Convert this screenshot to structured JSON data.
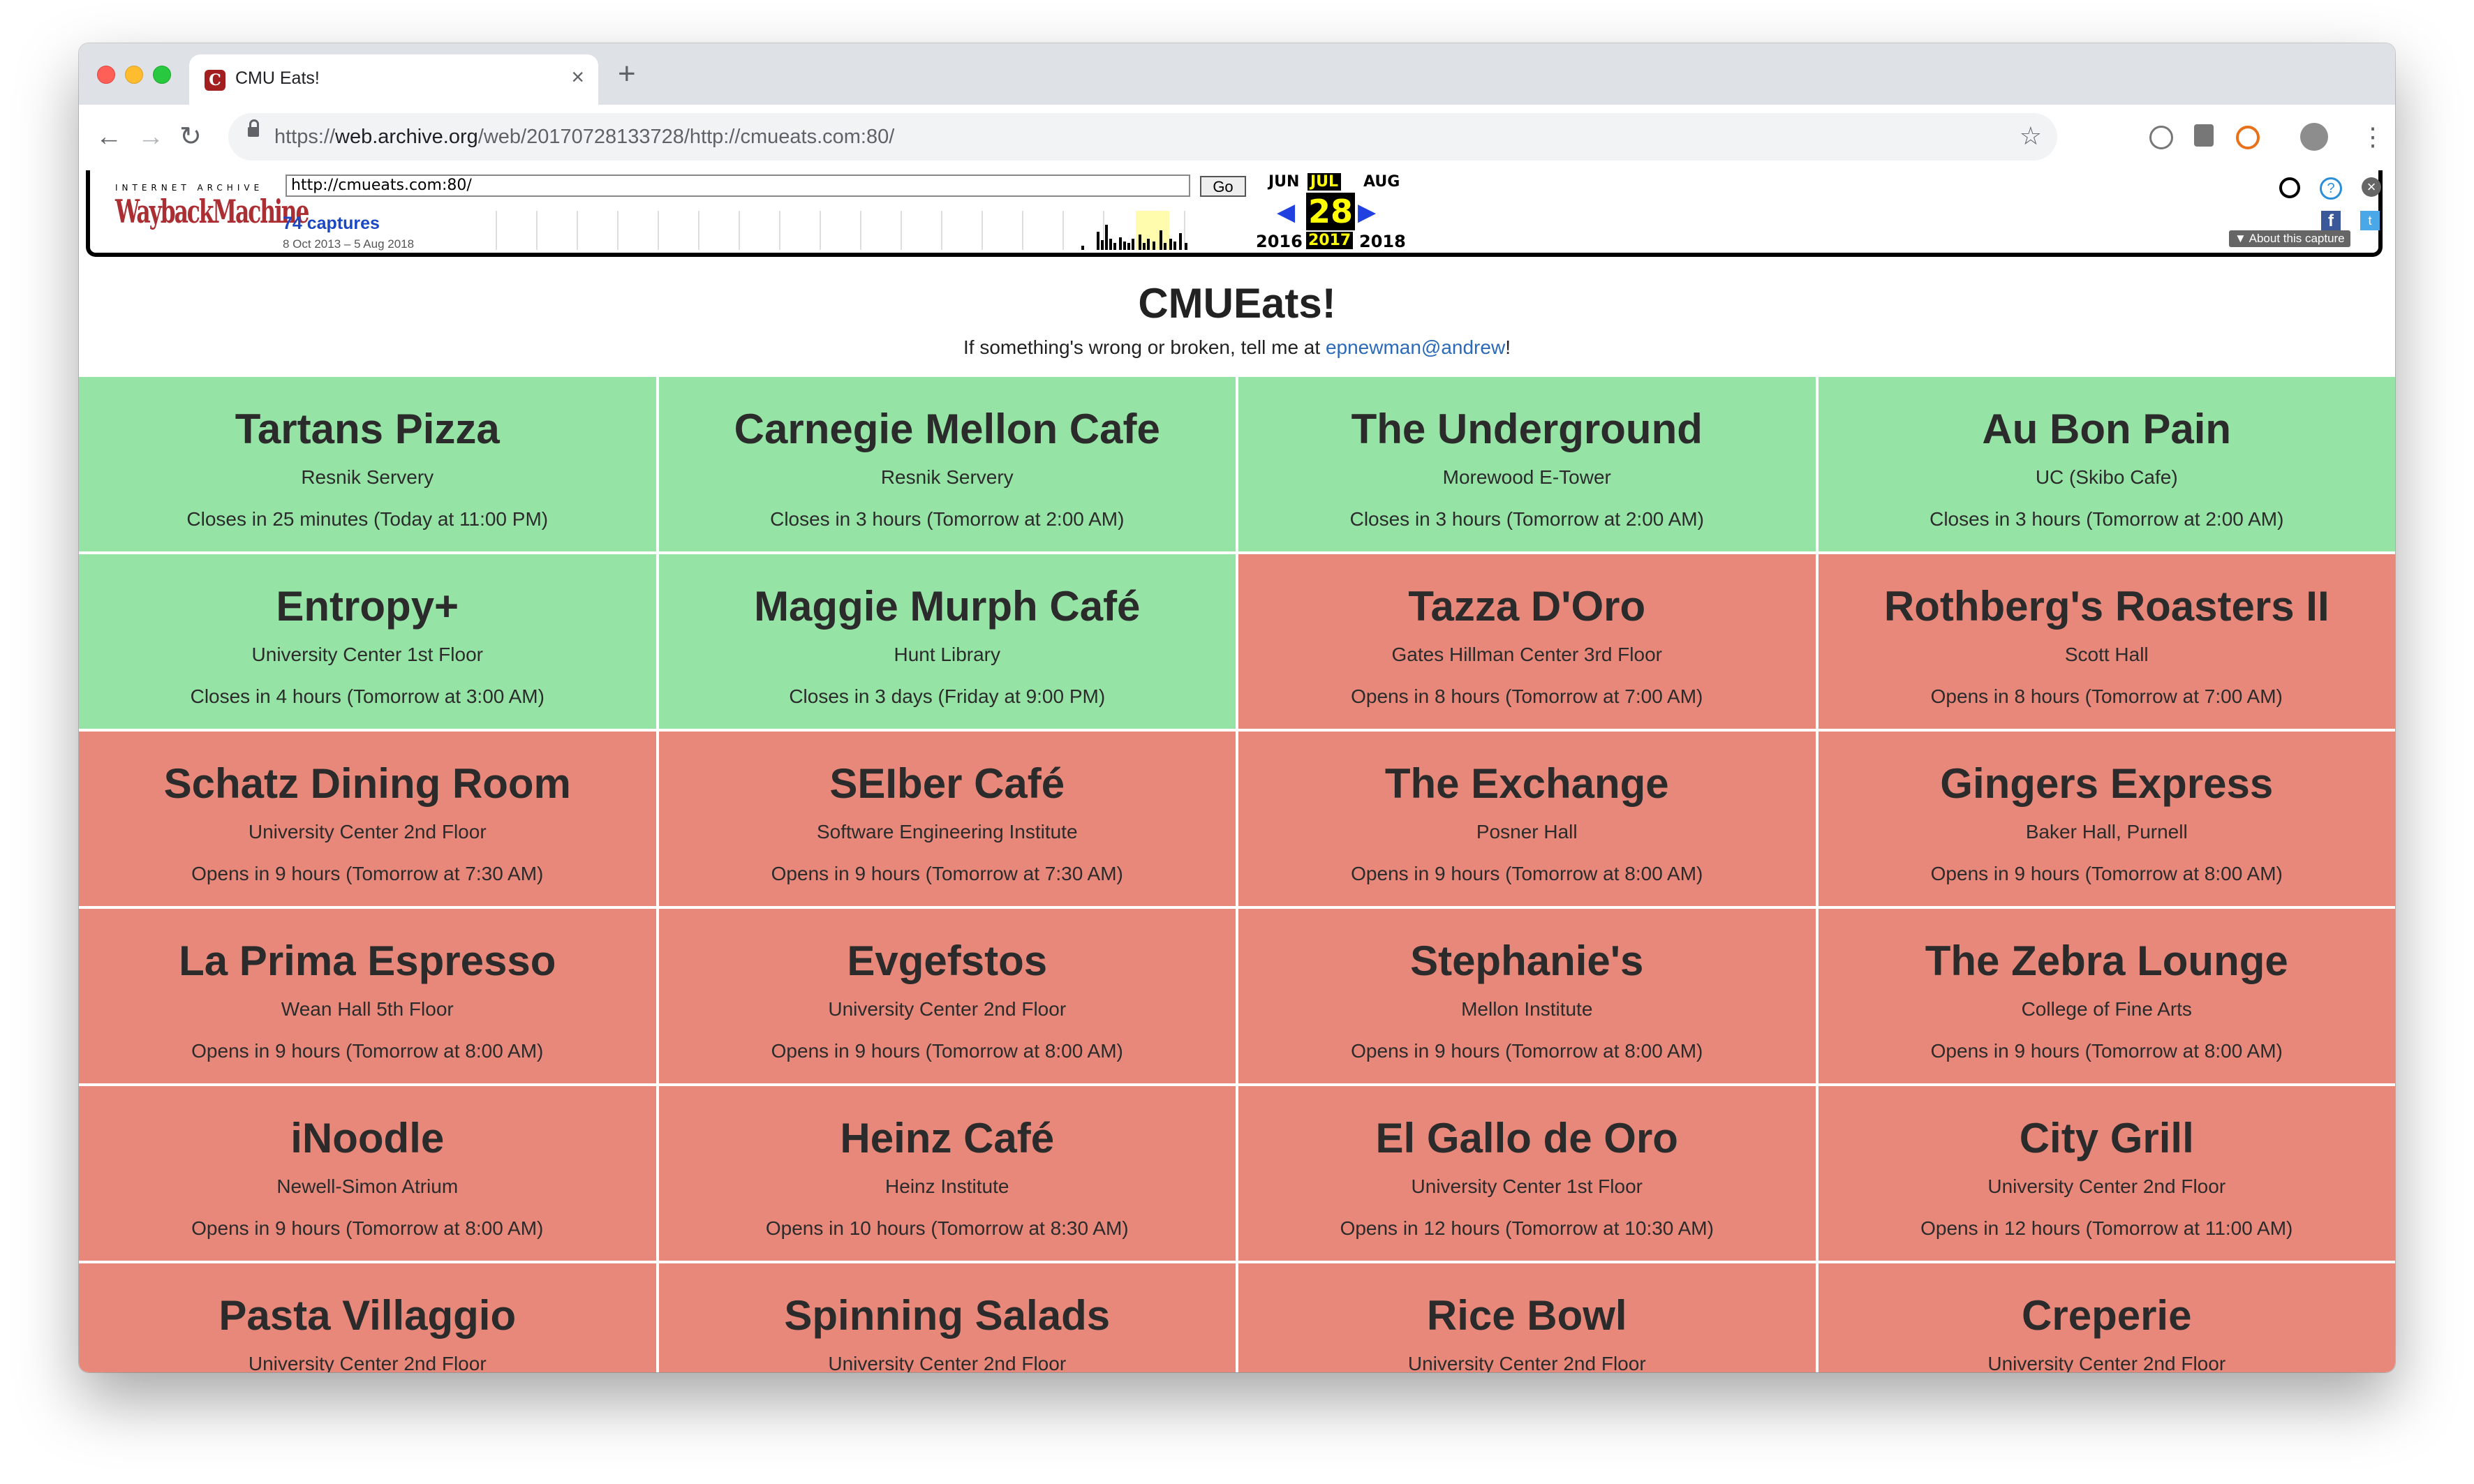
{
  "tab": {
    "favicon": "C",
    "title": "CMU Eats!",
    "close": "×",
    "new_tab": "+"
  },
  "toolbar": {
    "back": "←",
    "forward": "→",
    "reload": "↻",
    "url_prefix": "https://",
    "url_host": "web.archive.org",
    "url_path": "/web/20170728133728/http://cmueats.com:80/",
    "star": "☆",
    "menu": "⋮"
  },
  "wayback": {
    "logo_top": "INTERNET ARCHIVE",
    "logo": "WaybackMachine",
    "url_value": "http://cmueats.com:80/",
    "go_label": "Go",
    "captures": "74 captures",
    "range": "8 Oct 2013 – 5 Aug 2018",
    "months": {
      "prev": "JUN",
      "cur": "JUL",
      "next": "AUG"
    },
    "day": "28",
    "years": {
      "prev": "2016",
      "cur": "2017",
      "next": "2018"
    },
    "prev_arrow": "◀",
    "next_arrow": "▶",
    "help": "?",
    "close": "×",
    "fb": "f",
    "tw": "t",
    "about": "▼ About this capture"
  },
  "site": {
    "title": "CMUEats!",
    "sub_before": "If something's wrong or broken, tell me at ",
    "sub_link": "epnewman@andrew",
    "sub_after": "!"
  },
  "colors": {
    "open": "#95e3a5",
    "closed": "#e8887a",
    "link": "#2a6ab8"
  },
  "locations": [
    {
      "name": "Tartans Pizza",
      "location": "Resnik Servery",
      "status": "Closes in 25 minutes (Today at 11:00 PM)",
      "open": true
    },
    {
      "name": "Carnegie Mellon Cafe",
      "location": "Resnik Servery",
      "status": "Closes in 3 hours (Tomorrow at 2:00 AM)",
      "open": true
    },
    {
      "name": "The Underground",
      "location": "Morewood E-Tower",
      "status": "Closes in 3 hours (Tomorrow at 2:00 AM)",
      "open": true
    },
    {
      "name": "Au Bon Pain",
      "location": "UC (Skibo Cafe)",
      "status": "Closes in 3 hours (Tomorrow at 2:00 AM)",
      "open": true
    },
    {
      "name": "Entropy+",
      "location": "University Center 1st Floor",
      "status": "Closes in 4 hours (Tomorrow at 3:00 AM)",
      "open": true
    },
    {
      "name": "Maggie Murph Café",
      "location": "Hunt Library",
      "status": "Closes in 3 days (Friday at 9:00 PM)",
      "open": true
    },
    {
      "name": "Tazza D'Oro",
      "location": "Gates Hillman Center 3rd Floor",
      "status": "Opens in 8 hours (Tomorrow at 7:00 AM)",
      "open": false
    },
    {
      "name": "Rothberg's Roasters II",
      "location": "Scott Hall",
      "status": "Opens in 8 hours (Tomorrow at 7:00 AM)",
      "open": false
    },
    {
      "name": "Schatz Dining Room",
      "location": "University Center 2nd Floor",
      "status": "Opens in 9 hours (Tomorrow at 7:30 AM)",
      "open": false
    },
    {
      "name": "SEIber Café",
      "location": "Software Engineering Institute",
      "status": "Opens in 9 hours (Tomorrow at 7:30 AM)",
      "open": false
    },
    {
      "name": "The Exchange",
      "location": "Posner Hall",
      "status": "Opens in 9 hours (Tomorrow at 8:00 AM)",
      "open": false
    },
    {
      "name": "Gingers Express",
      "location": "Baker Hall, Purnell",
      "status": "Opens in 9 hours (Tomorrow at 8:00 AM)",
      "open": false
    },
    {
      "name": "La Prima Espresso",
      "location": "Wean Hall 5th Floor",
      "status": "Opens in 9 hours (Tomorrow at 8:00 AM)",
      "open": false
    },
    {
      "name": "Evgefstos",
      "location": "University Center 2nd Floor",
      "status": "Opens in 9 hours (Tomorrow at 8:00 AM)",
      "open": false
    },
    {
      "name": "Stephanie's",
      "location": "Mellon Institute",
      "status": "Opens in 9 hours (Tomorrow at 8:00 AM)",
      "open": false
    },
    {
      "name": "The Zebra Lounge",
      "location": "College of Fine Arts",
      "status": "Opens in 9 hours (Tomorrow at 8:00 AM)",
      "open": false
    },
    {
      "name": "iNoodle",
      "location": "Newell-Simon Atrium",
      "status": "Opens in 9 hours (Tomorrow at 8:00 AM)",
      "open": false
    },
    {
      "name": "Heinz Café",
      "location": "Heinz Institute",
      "status": "Opens in 10 hours (Tomorrow at 8:30 AM)",
      "open": false
    },
    {
      "name": "El Gallo de Oro",
      "location": "University Center 1st Floor",
      "status": "Opens in 12 hours (Tomorrow at 10:30 AM)",
      "open": false
    },
    {
      "name": "City Grill",
      "location": "University Center 2nd Floor",
      "status": "Opens in 12 hours (Tomorrow at 11:00 AM)",
      "open": false
    },
    {
      "name": "Pasta Villaggio",
      "location": "University Center 2nd Floor",
      "status": "",
      "open": false
    },
    {
      "name": "Spinning Salads",
      "location": "University Center 2nd Floor",
      "status": "",
      "open": false
    },
    {
      "name": "Rice Bowl",
      "location": "University Center 2nd Floor",
      "status": "",
      "open": false
    },
    {
      "name": "Creperie",
      "location": "University Center 2nd Floor",
      "status": "",
      "open": false
    }
  ]
}
